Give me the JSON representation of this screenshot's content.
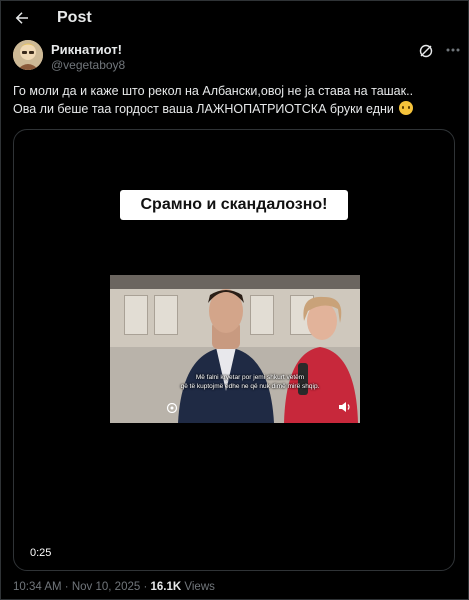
{
  "header": {
    "title": "Post"
  },
  "author": {
    "display_name": "Рикнатиот!",
    "handle": "@vegetaboy8"
  },
  "tweet": {
    "line1": "Го моли да и каже што рекол на Албански,овој не ја става на ташак..",
    "line2": "Ова ли беше таа гордост ваша ЛАЖНОПАТРИОТСКА бруки едни",
    "emoji": "weary-face-emoji"
  },
  "media": {
    "caption": "Срамно и скандалозно!",
    "subtitle_line1": "Më falni kryetar por jemi shkurt vetëm",
    "subtitle_line2": "që të kuptojmë edhe ne që nuk dimë mirë shqip.",
    "duration": "0:25"
  },
  "meta": {
    "time": "10:34 AM",
    "date": "Nov 10, 2025",
    "separator": "·",
    "views_count": "16.1K",
    "views_label": "Views"
  },
  "icons": {
    "back": "arrow-left-icon",
    "grok": "grok-icon",
    "more": "more-icon",
    "speaker": "speaker-icon"
  },
  "colors": {
    "background": "#000000",
    "text_primary": "#e7e9ea",
    "text_secondary": "#71767b",
    "border": "#2f3336"
  }
}
